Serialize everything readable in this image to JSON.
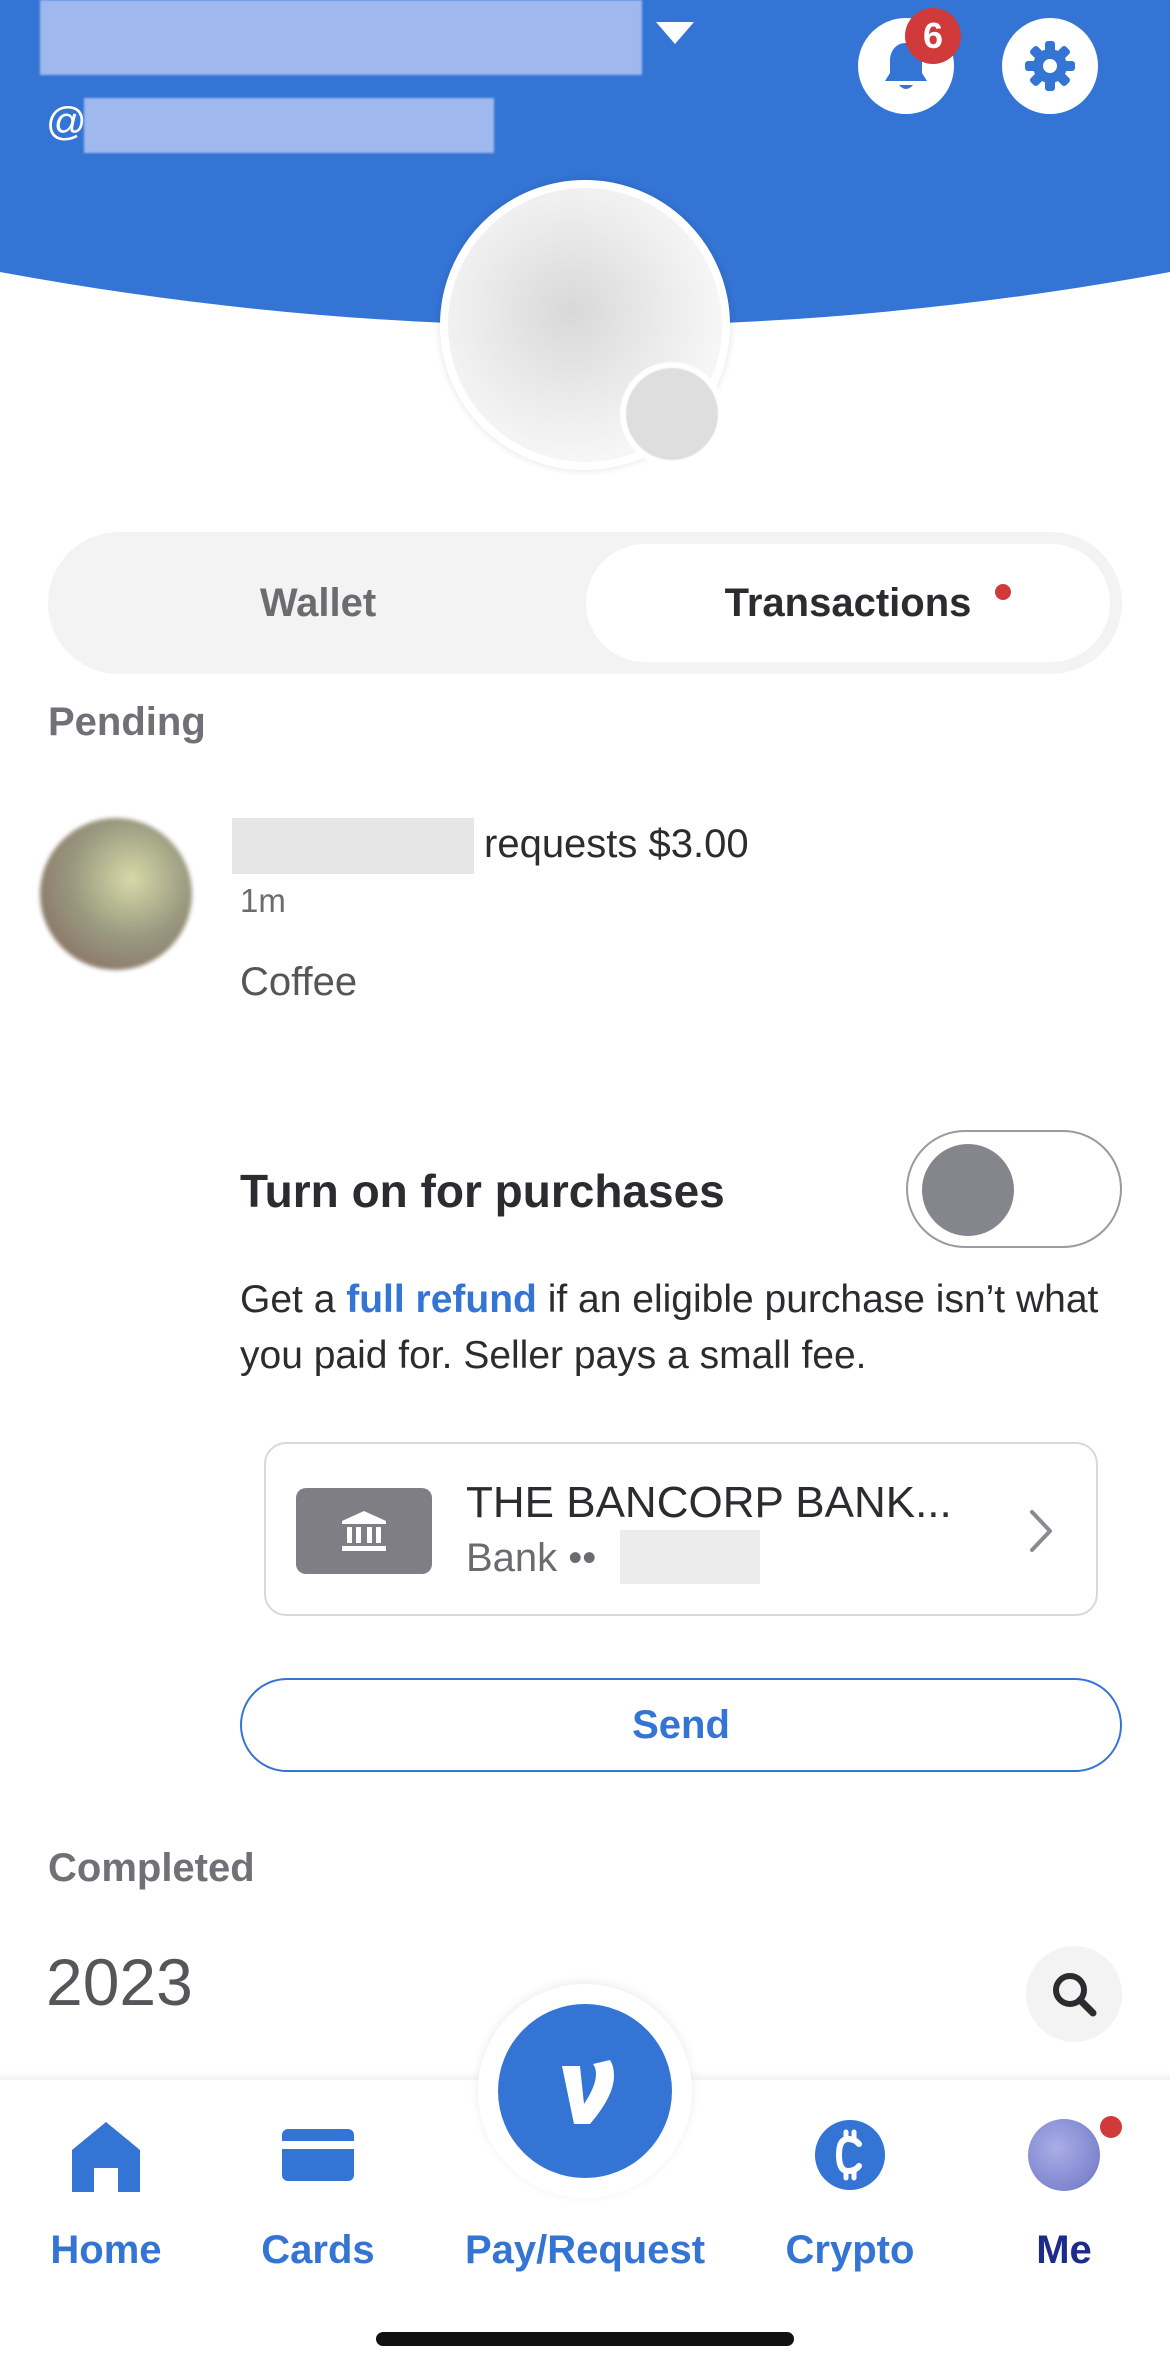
{
  "header": {
    "handle_prefix": "@",
    "notification_count": "6",
    "accent_color": "#3474d4"
  },
  "tabs": {
    "wallet_label": "Wallet",
    "transactions_label": "Transactions",
    "selected": "Transactions"
  },
  "pending": {
    "section_label": "Pending",
    "request": {
      "text": "requests $3.00",
      "time": "1m",
      "note": "Coffee"
    },
    "purchase_protection": {
      "title": "Turn on for purchases",
      "toggle_on": false,
      "desc_prefix": "Get a ",
      "link_text": "full refund",
      "desc_suffix": " if an eligible purchase isn’t what you paid for. Seller pays a small fee."
    },
    "bank": {
      "name": "THE BANCORP BANK...",
      "type_label": "Bank ••"
    },
    "send_label": "Send"
  },
  "completed": {
    "section_label": "Completed",
    "year": "2023"
  },
  "nav": {
    "home": "Home",
    "cards": "Cards",
    "pay_request": "Pay/Request",
    "crypto": "Crypto",
    "me": "Me",
    "active": "Me"
  },
  "icons": {
    "header": [
      "chevron-down-icon",
      "bell-icon",
      "gear-icon"
    ],
    "bank": "bank-icon",
    "search": "search-icon",
    "nav": [
      "home-icon",
      "card-icon",
      "venmo-logo-icon",
      "crypto-icon",
      "avatar"
    ]
  }
}
